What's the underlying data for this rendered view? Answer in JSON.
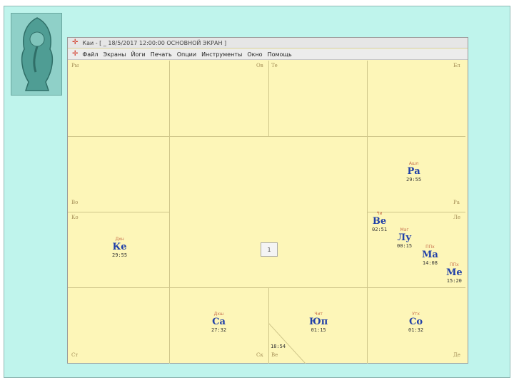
{
  "window": {
    "title": "Каи - [ _ 18/5/2017 12:00:00      ОСНОВНОЙ ЭКРАН ]"
  },
  "menu": [
    "Файл",
    "Экраны",
    "Йоги",
    "Печать",
    "Опции",
    "Инструменты",
    "Окно",
    "Помощь"
  ],
  "houses": {
    "ry": "Ры",
    "ov": "Ов",
    "te": "Те",
    "bl": "Бл",
    "vo": "Во",
    "ra": "Ра",
    "ko": "Ко",
    "le": "Ле",
    "st": "Ст",
    "sk": "Ск",
    "ve": "Ве",
    "de": "Де"
  },
  "planets": {
    "ra": {
      "nak": "Ашл",
      "name": "Ра",
      "deg": "29:55"
    },
    "ve": {
      "nak": "Чи",
      "name": "Ве",
      "deg": "02:51"
    },
    "lu": {
      "nak": "Маг",
      "name": "Лу",
      "deg": "00:15"
    },
    "ma": {
      "nak": "ППх",
      "name": "Ма",
      "deg": "14:08"
    },
    "me": {
      "nak": "ППх",
      "name": "Ме",
      "deg": "15:20"
    },
    "ke": {
      "nak": "Дхн",
      "name": "Ке",
      "deg": "29:55"
    },
    "sa": {
      "nak": "Дхш",
      "name": "Са",
      "deg": "27:32"
    },
    "yup": {
      "nak": "Чит",
      "name": "Юп",
      "deg": "01:15"
    },
    "so": {
      "nak": "Утх",
      "name": "Со",
      "deg": "01:32"
    }
  },
  "asc_degree": "18:54",
  "center_button": "1"
}
